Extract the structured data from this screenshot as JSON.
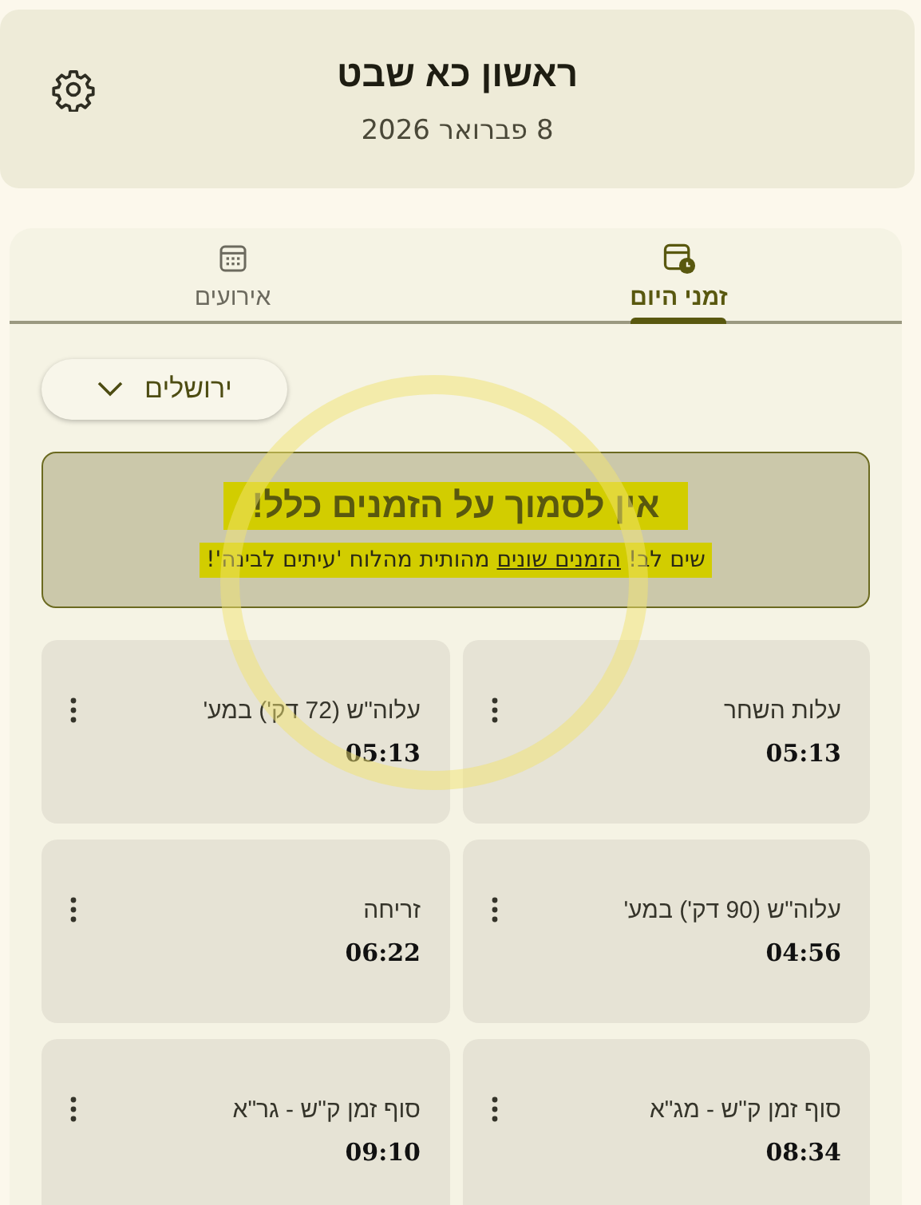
{
  "header": {
    "title": "ראשון כא שבט",
    "date": "8 פברואר 2026"
  },
  "tabs": [
    {
      "label": "זמני היום",
      "selected": true,
      "kind": "clock"
    },
    {
      "label": "אירועים",
      "selected": false,
      "kind": "calendar"
    }
  ],
  "location": {
    "value": "ירושלים"
  },
  "warning": {
    "title": "אין לסמוך על הזמנים כלל!",
    "note_before": "שים לב!",
    "note_link": "הזמנים שונים",
    "note_after": "מהותית מהלוח 'עיתים לבינה'!",
    "highlighted": true
  },
  "times": [
    {
      "name": "עלות השחר",
      "time": "05:13"
    },
    {
      "name": "עלוה\"ש (72 דק') במע'",
      "time": "05:13"
    },
    {
      "name": "עלוה\"ש (90 דק') במע'",
      "time": "04:56"
    },
    {
      "name": "זריחה",
      "time": "06:22"
    },
    {
      "name": "סוף זמן ק\"ש - מג\"א",
      "time": "08:34"
    },
    {
      "name": "סוף זמן ק\"ש - גר\"א",
      "time": "09:10"
    }
  ]
}
